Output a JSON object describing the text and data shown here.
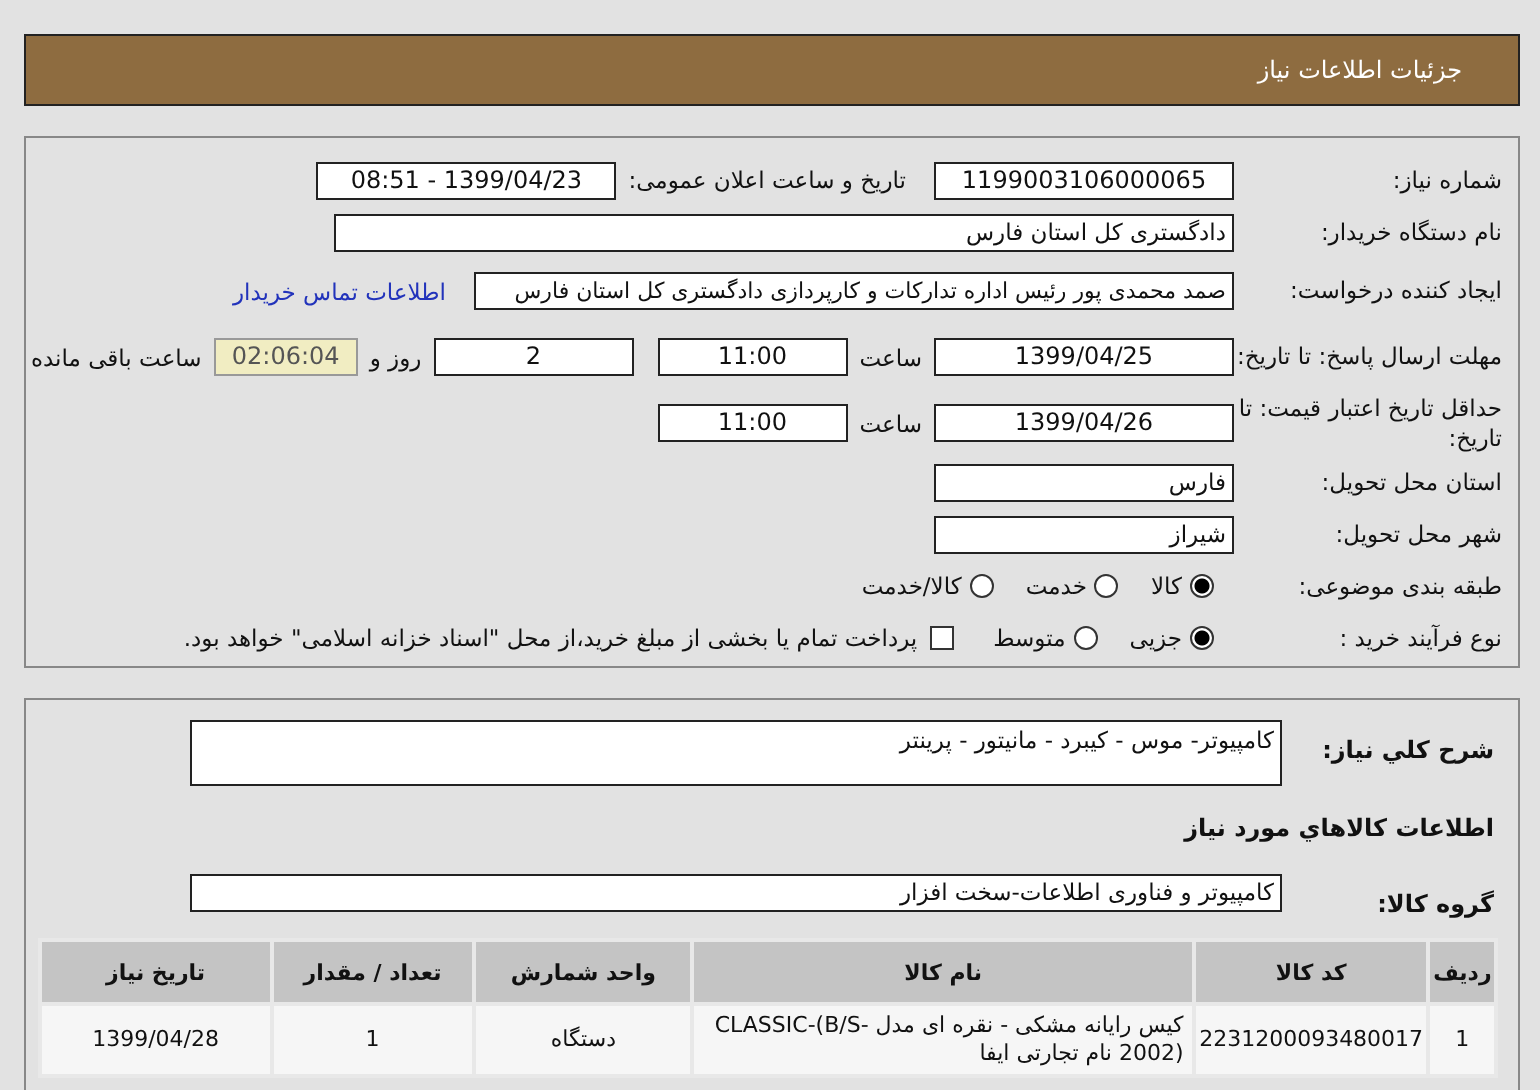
{
  "header": {
    "title": "جزئیات اطلاعات نیاز"
  },
  "details": {
    "need_number": {
      "label": "شماره نیاز:",
      "value": "1199003106000065"
    },
    "announce": {
      "label": "تاریخ و ساعت اعلان عمومی:",
      "value": "1399/04/23 - 08:51"
    },
    "buyer": {
      "label": "نام دستگاه خریدار:",
      "value": "دادگستری کل استان فارس"
    },
    "creator": {
      "label": "ایجاد کننده درخواست:",
      "value": "صمد محمدی پور رئیس اداره تدارکات و کارپردازی دادگستری کل استان فارس",
      "link": "اطلاعات تماس خریدار"
    },
    "deadline": {
      "label": "مهلت ارسال پاسخ: تا تاریخ:",
      "date": "1399/04/25",
      "time_label": "ساعت",
      "time": "11:00",
      "days": "2",
      "days_label": "روز و",
      "countdown": "02:06:04",
      "remaining_label": "ساعت باقی مانده"
    },
    "validity": {
      "label": "حداقل تاریخ اعتبار قیمت: تا تاریخ:",
      "date": "1399/04/26",
      "time_label": "ساعت",
      "time": "11:00"
    },
    "province": {
      "label": "استان محل تحویل:",
      "value": "فارس"
    },
    "city": {
      "label": "شهر محل تحویل:",
      "value": "شیراز"
    },
    "category": {
      "label": "طبقه بندی موضوعی:",
      "options": [
        {
          "label": "کالا",
          "selected": true
        },
        {
          "label": "خدمت",
          "selected": false
        },
        {
          "label": "کالا/خدمت",
          "selected": false
        }
      ]
    },
    "process": {
      "label": "نوع فرآیند خرید :",
      "options": [
        {
          "label": "جزیی",
          "selected": true
        },
        {
          "label": "متوسط",
          "selected": false
        }
      ],
      "treasury": {
        "label": "پرداخت تمام یا بخشی از مبلغ خرید،از محل \"اسناد خزانه اسلامی\" خواهد بود.",
        "checked": false
      }
    }
  },
  "summary": {
    "label": "شرح کلي نیاز:",
    "value": "کامپیوتر- موس - کیبرد - مانیتور - پرینتر"
  },
  "goods_title": "اطلاعات کالاهاي مورد نیاز",
  "goods_group": {
    "label": "گروه کالا:",
    "value": "کامپیوتر و فناوری اطلاعات-سخت افزار"
  },
  "table": {
    "columns": [
      "ردیف",
      "کد کالا",
      "نام کالا",
      "واحد شمارش",
      "تعداد / مقدار",
      "تاریخ نیاز"
    ],
    "rows": [
      [
        "1",
        "2231200093480017",
        "کیس رایانه مشکی - نقره ای مدل CLASSIC-(B/S-2002) نام تجارتی ایفا",
        "دستگاه",
        "1",
        "1399/04/28"
      ]
    ]
  }
}
